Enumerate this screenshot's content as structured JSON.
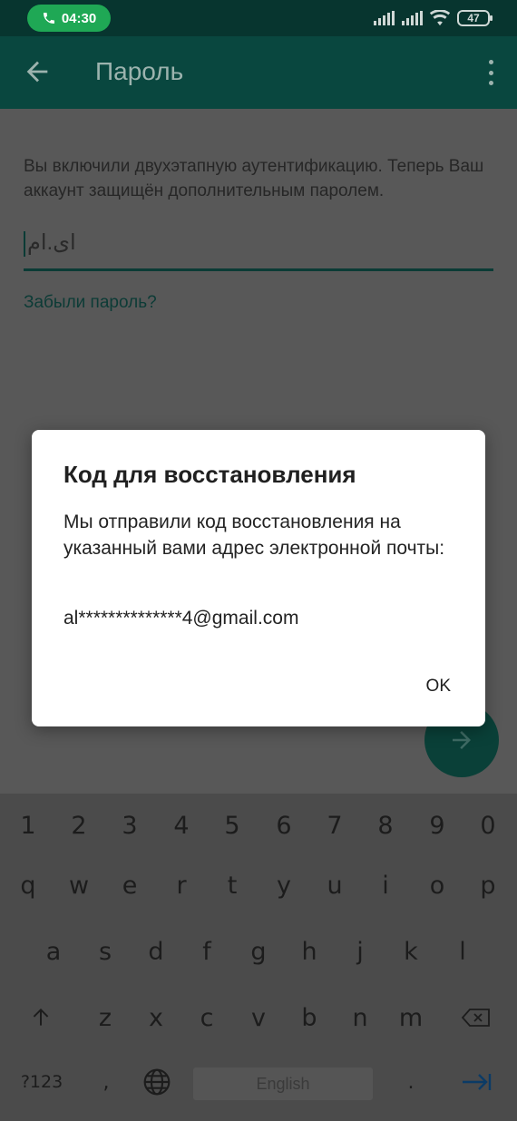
{
  "status_bar": {
    "call_time": "04:30",
    "battery": "47"
  },
  "app_bar": {
    "title": "Пароль"
  },
  "content": {
    "description": "Вы включили двухэтапную аутентификацию. Теперь Ваш аккаунт защищён дополнительным паролем.",
    "password_value": "ای.ام",
    "forgot_link": "Забыли пароль?"
  },
  "dialog": {
    "title": "Код для восстановления",
    "message": "Мы отправили код восстановления на указанный вами адрес электронной почты:",
    "email": "al**************4@gmail.com",
    "ok_label": "OK"
  },
  "keyboard": {
    "digits": [
      "1",
      "2",
      "3",
      "4",
      "5",
      "6",
      "7",
      "8",
      "9",
      "0"
    ],
    "row1": [
      "q",
      "w",
      "e",
      "r",
      "t",
      "y",
      "u",
      "i",
      "o",
      "p"
    ],
    "row2": [
      "a",
      "s",
      "d",
      "f",
      "g",
      "h",
      "j",
      "k",
      "l"
    ],
    "row3": [
      "z",
      "x",
      "c",
      "v",
      "b",
      "n",
      "m"
    ],
    "symbols_label": "?123",
    "comma": ",",
    "space_label": "English",
    "period": "."
  },
  "colors": {
    "status_bar": "#07352f",
    "app_bar": "#09473f",
    "call_pill": "#1fa855",
    "fab": "#0a4038",
    "dialog": "#ffffff"
  },
  "icons": [
    "phone-icon",
    "signal-icon",
    "wifi-icon",
    "battery-icon",
    "back-arrow-icon",
    "more-vert-icon",
    "arrow-right-icon",
    "shift-icon",
    "backspace-icon",
    "globe-icon",
    "enter-icon"
  ]
}
